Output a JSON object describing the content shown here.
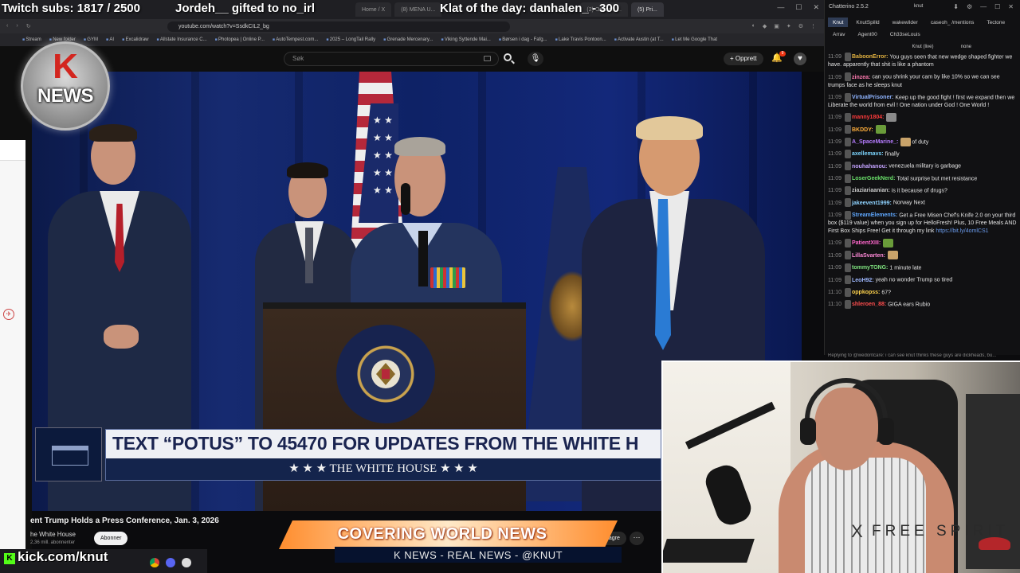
{
  "stream_overlay": {
    "subs_goal": "Twitch subs: 1817 / 2500",
    "gifted": "Jordeh__ gifted to no_irl",
    "klat": "Klat of the day: danhalen_ - 300"
  },
  "browser": {
    "tabs": [
      "Home / X",
      "(8) MENA U...",
      "(2) On walk ...",
      "(5) Pri..."
    ],
    "url": "youtube.com/watch?v=SsdkCIL2_bg",
    "bookmarks": [
      "Stream",
      "New folder",
      "GYM",
      "AI",
      "Excalidraw",
      "Allstate Insurance C...",
      "Photopea | Online P...",
      "AutoTempest.com...",
      "2025 – LongTail Rally",
      "Grenade Mercenary...",
      "Viking Syttende Mai...",
      "Børsen i dag - Fafg...",
      "Lake Travis Pontoon...",
      "Activate Austin (at T...",
      "Let Me Google That"
    ]
  },
  "youtube": {
    "search_placeholder": "Søk",
    "create_label": "Opprett",
    "bell_badge": "9",
    "video_title": "ent Trump Holds a Press Conference, Jan. 3, 2026",
    "channel": "he White House",
    "subscribers": "2,36 mill. abonnenter",
    "subscribe_label": "Abonner",
    "save_label": "Lagre",
    "more_label": "···"
  },
  "video": {
    "banner_text": "TEXT “POTUS” TO 45470 FOR UPDATES FROM THE WHITE H",
    "banner_sub": "★ ★ ★   THE WHITE HOUSE   ★ ★ ★"
  },
  "knews": {
    "k": "K",
    "news": "NEWS"
  },
  "lower_third": {
    "cover": "COVERING WORLD NEWS",
    "tagline": "K NEWS - REAL NEWS - @KNUT"
  },
  "kick": {
    "logo": "K",
    "text": "kick.com/knut"
  },
  "chat": {
    "app_title": "Chatterino 2.5.2",
    "user": "knut",
    "tabs_row1": [
      "Knut",
      "KnutSpilld",
      "wakewilder",
      "caseoh_ /mentions"
    ],
    "tabs_row2": [
      "Tectone",
      "Arrav",
      "Agent00",
      "Ch33seLouis"
    ],
    "channel_head": "Knut (live)",
    "channel_mode": "none",
    "messages": [
      {
        "ts": "11:09",
        "user": "BaboonError:",
        "color": "#e3b341",
        "text": "You guys seen that new wedge shaped fighter we have. apparently that shit is like a phantom"
      },
      {
        "ts": "11:09",
        "user": "zinzea:",
        "color": "#ff7ab0",
        "text": "can you shrink your cam by like 10% so we can see trumps face as he sleeps knut"
      },
      {
        "ts": "11:09",
        "user": "VirtualPrisoner:",
        "color": "#8fb4ff",
        "text": "Keep up the good fight ! first we expand then we Liberate the world from evil ! One nation under God ! One World !"
      },
      {
        "ts": "11:09",
        "user": "manny1804:",
        "color": "#ff3b3b",
        "text": ""
      },
      {
        "ts": "11:09",
        "user": "BKDDY:",
        "color": "#ffae3b",
        "text": ""
      },
      {
        "ts": "11:09",
        "user": "A_SpaceMarine_:",
        "color": "#b57bff",
        "text": "of duty"
      },
      {
        "ts": "11:09",
        "user": "axellemavs:",
        "color": "#7cd6ff",
        "text": "finally"
      },
      {
        "ts": "11:09",
        "user": "nouhahanou:",
        "color": "#c4a3ff",
        "text": "venezuela military is garbage"
      },
      {
        "ts": "11:09",
        "user": "LoserGeekNerd:",
        "color": "#6be36b",
        "text": "Total surprise but met resistance"
      },
      {
        "ts": "11:09",
        "user": "ziaziariaanian:",
        "color": "#c9c9c9",
        "text": "is it because of drugs?"
      },
      {
        "ts": "11:09",
        "user": "jakeevent1999:",
        "color": "#8fd3ff",
        "text": "Norway Next"
      },
      {
        "ts": "11:09",
        "user": "StreamElements:",
        "color": "#5fa8ff",
        "text": "Get a Free Misen Chef's Knife 2.0 on your third box ($119 value) when you sign up for HelloFresh! Plus, 10 Free Meals AND First Box Ships Free! Get it through my link",
        "link": "https://bit.ly/4omlCS1"
      },
      {
        "ts": "11:09",
        "user": "PatientXIII:",
        "color": "#ff66cc",
        "text": ""
      },
      {
        "ts": "11:09",
        "user": "LillaSvarten:",
        "color": "#ff8ad8",
        "text": ""
      },
      {
        "ts": "11:09",
        "user": "tommyTONG:",
        "color": "#7fe37f",
        "text": "1 minute late"
      },
      {
        "ts": "11:09",
        "user": "LeoH92:",
        "color": "#9fb9ff",
        "text": "yeah no wonder Trump so tired"
      },
      {
        "ts": "11:10",
        "user": "oppkopss:",
        "color": "#ffd34d",
        "text": "67?"
      },
      {
        "ts": "11:10",
        "user": "shleroen_88:",
        "color": "#ff4d4d",
        "text": "GIGA ears Rubio"
      }
    ],
    "reply_line": "Replying to @wedontcare: i can see knut thinks these guys are dickheads, bu..."
  },
  "cam": {
    "brand": "FREE SPIRIT",
    "brand_icon": "X"
  }
}
